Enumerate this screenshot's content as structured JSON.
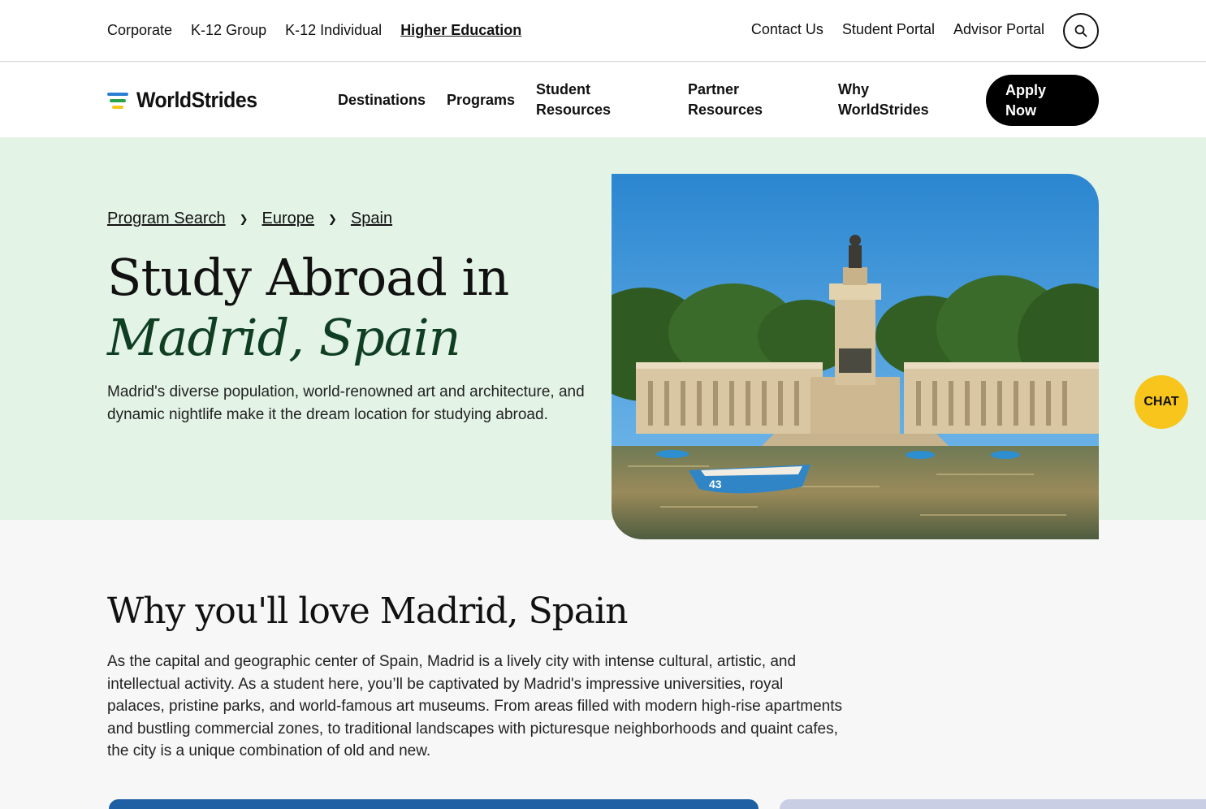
{
  "utility_nav": {
    "left_items": [
      "Corporate",
      "K-12 Group",
      "K-12 Individual",
      "Higher Education"
    ],
    "active_item": "Higher Education",
    "right_items": [
      "Contact Us",
      "Student Portal",
      "Advisor Portal"
    ]
  },
  "brand": {
    "name": "WorldStrides",
    "colors": {
      "green": "#2aa34a",
      "yellow": "#f7c51b",
      "blue": "#2a7fd4"
    }
  },
  "main_nav": {
    "items": [
      "Destinations",
      "Programs",
      "Student Resources",
      "Partner Resources",
      "Why WorldStrides"
    ],
    "cta": "Apply Now"
  },
  "breadcrumb": [
    "Program Search",
    "Europe",
    "Spain"
  ],
  "hero": {
    "title_line1": "Study Abroad in",
    "title_line2": "Madrid, Spain",
    "description": "Madrid's diverse population, world-renowned art and architecture, and dynamic nightlife make it the dream location for studying abroad.",
    "boat_number": "43"
  },
  "chat": {
    "label": "CHAT"
  },
  "intro": {
    "heading": "Why you'll love Madrid, Spain",
    "body": "As the capital and geographic center of Spain, Madrid is a lively city with intense cultural, artistic, and intellectual activity. As a student here, you’ll be captivated by Madrid's impressive universities, royal palaces, pristine parks, and world-famous art museums. From areas filled with modern high-rise apartments and bustling commercial zones, to traditional landscapes with picturesque neighborhoods and quaint cafes, the city is a unique combination of old and new."
  },
  "icons": {
    "search": "search-icon",
    "breadcrumb_separator": "chevron-right-icon"
  },
  "theme": {
    "hero_background": "#e3f3e6",
    "accent_dark_green": "#0f3e23",
    "chat_yellow": "#f7c51b"
  }
}
